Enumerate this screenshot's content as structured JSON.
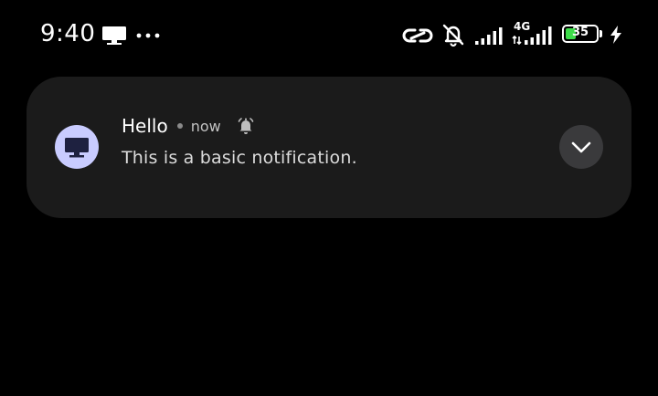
{
  "status_bar": {
    "time": "9:40",
    "network_type": "4G",
    "battery_percent": "35",
    "battery_level": 0.35,
    "icons": [
      "cast-icon",
      "more-icon",
      "link-icon",
      "bell-off-icon",
      "signal-icon",
      "signal-4g-icon",
      "battery-icon",
      "charging-icon"
    ]
  },
  "notification": {
    "app_name": "Hello",
    "time": "now",
    "message": "This is a basic notification.",
    "app_icon": "desktop-icon",
    "alert_icon": "bell-ringing-icon",
    "expand_icon": "chevron-down-icon"
  },
  "colors": {
    "background": "#000000",
    "card": "#1b1b1b",
    "app_icon_bg": "#c9ccff",
    "battery_fill": "#3ddc4a",
    "expand_button": "#3a3a3c"
  }
}
